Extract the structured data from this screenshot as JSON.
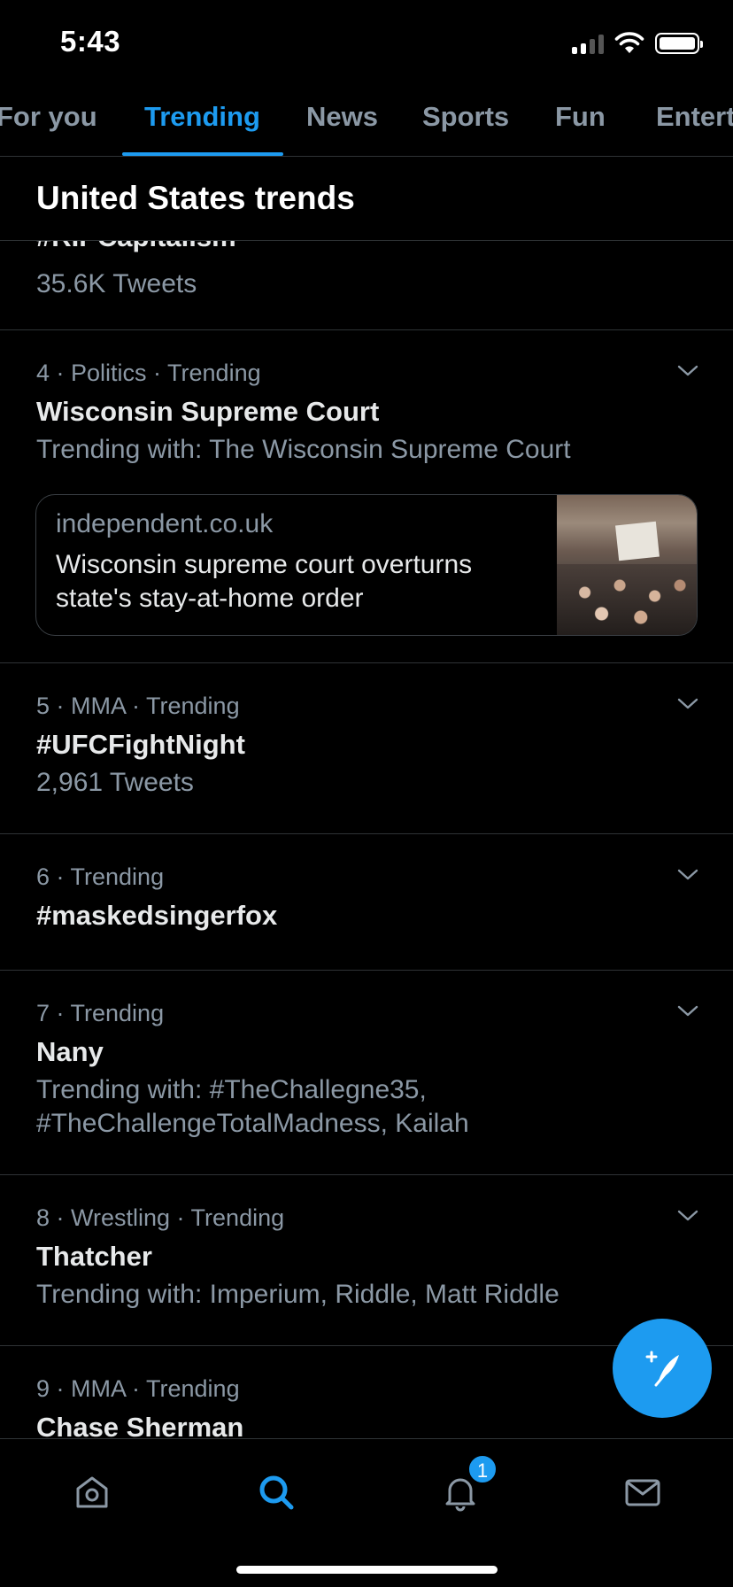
{
  "status": {
    "time": "5:43"
  },
  "tabs": [
    {
      "label": "For you",
      "active": false
    },
    {
      "label": "Trending",
      "active": true
    },
    {
      "label": "News",
      "active": false
    },
    {
      "label": "Sports",
      "active": false
    },
    {
      "label": "Fun",
      "active": false
    },
    {
      "label": "Entert",
      "active": false
    }
  ],
  "section": {
    "title": "United States trends"
  },
  "trends": [
    {
      "name": "#RIPCapitalism",
      "sub": "35.6K Tweets"
    },
    {
      "meta": "4 · Politics · Trending",
      "name": "Wisconsin Supreme Court",
      "sub": "Trending with: The Wisconsin Supreme Court",
      "card": {
        "source": "independent.co.uk",
        "headline": "Wisconsin supreme court overturns state's stay-at-home order"
      }
    },
    {
      "meta": "5 · MMA · Trending",
      "name": "#UFCFightNight",
      "sub": "2,961 Tweets"
    },
    {
      "meta": "6 · Trending",
      "name": "#maskedsingerfox"
    },
    {
      "meta": "7 · Trending",
      "name": "Nany",
      "sub": "Trending with: #TheChallegne35, #TheChallengeTotalMadness, Kailah"
    },
    {
      "meta": "8 · Wrestling · Trending",
      "name": "Thatcher",
      "sub": "Trending with: Imperium, Riddle, Matt Riddle"
    },
    {
      "meta": "9 · MMA · Trending",
      "name": "Chase Sherman"
    }
  ],
  "nav": {
    "notifications_badge": "1"
  },
  "colors": {
    "accent": "#1d9bf0",
    "background": "#000000",
    "secondary_text": "#8b98a5"
  },
  "icons": [
    "home-icon",
    "search-icon",
    "bell-icon",
    "mail-icon",
    "compose-icon",
    "chevron-down-icon"
  ]
}
